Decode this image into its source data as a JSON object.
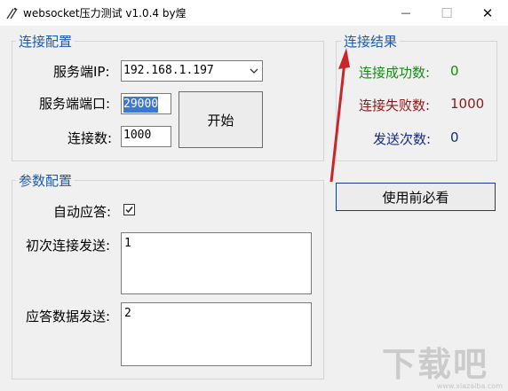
{
  "window": {
    "title": "websocket压力测试 v1.0.4 by煌",
    "minimize_glyph": "—",
    "maximize_glyph": "☐",
    "close_glyph": "✕"
  },
  "connection_config": {
    "group_title": "连接配置",
    "server_ip_label": "服务端IP:",
    "server_ip_value": "192.168.1.197",
    "server_port_label": "服务端端口:",
    "server_port_value": "29000",
    "connections_label": "连接数:",
    "connections_value": "1000",
    "start_button": "开始"
  },
  "connection_results": {
    "group_title": "连接结果",
    "success_label": "连接成功数:",
    "success_value": "0",
    "success_color": "#1a8a1a",
    "fail_label": "连接失败数:",
    "fail_value": "1000",
    "fail_color": "#8b1a1a",
    "sent_label": "发送次数:",
    "sent_value": "0",
    "sent_color": "#1a2a7a"
  },
  "help_button": "使用前必看",
  "param_config": {
    "group_title": "参数配置",
    "auto_reply_label": "自动应答:",
    "auto_reply_checked": true,
    "first_send_label": "初次连接发送:",
    "first_send_value": "1",
    "reply_data_label": "应答数据发送:",
    "reply_data_value": "2"
  },
  "watermark": {
    "text": "下载吧",
    "url": "www.xiazaiba.com"
  }
}
